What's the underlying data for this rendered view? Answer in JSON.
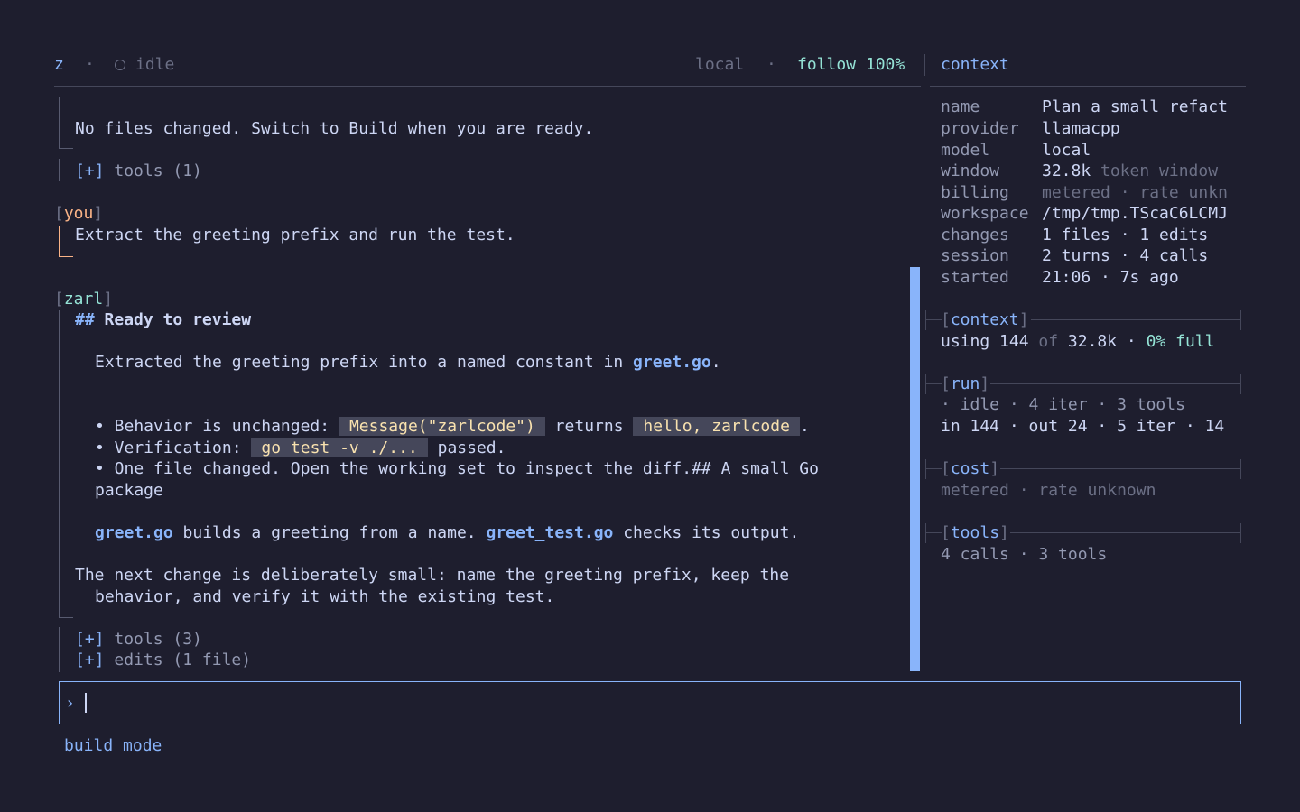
{
  "header": {
    "app": "z",
    "sep1": "·",
    "status_icon": "circle-outline-icon",
    "status": "idle",
    "host": "local",
    "sep2": "·",
    "follow": "follow 100%",
    "panel_title": "context"
  },
  "transcript": {
    "block1": {
      "text": "No files changed. Switch to Build when you are ready.",
      "tools_toggle": "[+]",
      "tools_label": "tools (1)"
    },
    "user": {
      "bracket_open": "[",
      "role": "you",
      "bracket_close": "]",
      "text": "Extract the greeting prefix and run the test."
    },
    "assistant": {
      "bracket_open": "[",
      "role": "zarl",
      "bracket_close": "]",
      "heading_marker": "##",
      "heading": "Ready to review",
      "p1_pre": "Extracted the greeting prefix into a named constant in ",
      "p1_code": "greet.go",
      "p1_post": ".",
      "b1_pre": "• Behavior is unchanged: ",
      "b1_code1": "Message(\"zarlcode\")",
      "b1_mid": " returns ",
      "b1_code2": "hello, zarlcode",
      "b1_post": ".",
      "b2_pre": "• Verification: ",
      "b2_code": "go test -v ./...",
      "b2_post": " passed.",
      "b3_line1": "• One file changed. Open the working set to inspect the diff.## A small Go",
      "b3_line2": "package",
      "p2_code1": "greet.go",
      "p2_mid": " builds a greeting from a name. ",
      "p2_code2": "greet_test.go",
      "p2_post": " checks its output.",
      "p3_line1": "The next change is deliberately small: name the greeting prefix, keep the",
      "p3_line2": "behavior, and verify it with the existing test.",
      "tools_toggle": "[+]",
      "tools_label": "tools (3)",
      "edits_toggle": "[+]",
      "edits_label": "edits (1 file)"
    }
  },
  "context_panel": {
    "rows": [
      {
        "key": "name",
        "value": "Plan a small refact",
        "extra": ""
      },
      {
        "key": "provider",
        "value": "llamacpp",
        "extra": ""
      },
      {
        "key": "model",
        "value": "local",
        "extra": ""
      },
      {
        "key": "window",
        "value": "32.8k",
        "extra": " token window"
      },
      {
        "key": "billing",
        "value": "",
        "extra": "metered · rate unkn"
      },
      {
        "key": "workspace",
        "value": "/tmp/tmp.TScaC6LCMJ",
        "extra": ""
      },
      {
        "key": "changes",
        "value": "1 files · 1 edits",
        "extra": ""
      },
      {
        "key": "session",
        "value": "2 turns · 4 calls",
        "extra": ""
      },
      {
        "key": "started",
        "value": "21:06 · 7s ago",
        "extra": ""
      }
    ],
    "context_section": {
      "title": "context",
      "pre": "using 144 ",
      "of": "of",
      "mid": " 32.8k · ",
      "pct": "0% full"
    },
    "run_section": {
      "title": "run",
      "line1": "· idle · 4 iter · 3 tools",
      "line2": "in 144 · out 24 · 5 iter · 14"
    },
    "cost_section": {
      "title": "cost",
      "line1": "metered · rate unknown"
    },
    "tools_section": {
      "title": "tools",
      "line1": "4 calls · 3 tools"
    }
  },
  "composer": {
    "prompt": "›",
    "value": ""
  },
  "footer": {
    "mode": "build mode"
  },
  "colors": {
    "background": "#1e1e2e",
    "accent_blue": "#89b4fa",
    "accent_teal": "#94e2d5",
    "user_peach": "#fab387",
    "code_bg": "#45475a",
    "code_fg": "#f9e2af"
  },
  "scroll": {
    "thumb_fraction": 0.68
  }
}
